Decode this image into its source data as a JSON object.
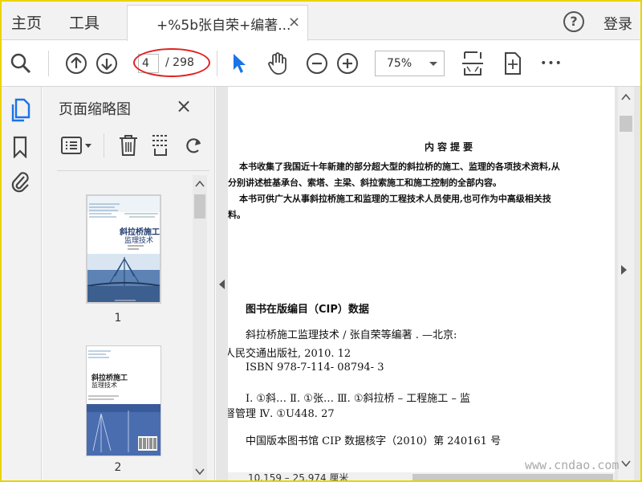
{
  "tabbar": {
    "home": "主页",
    "tools": "工具",
    "doc_tab_title": "+%5b张自荣+编著...",
    "close_glyph": "×",
    "help_glyph": "?",
    "login": "登录"
  },
  "toolbar": {
    "current_page": "4",
    "total_pages": "/ 298",
    "zoom": "75%",
    "more": "•••"
  },
  "sidebar": {
    "panel_title": "页面缩略图",
    "thumbnails": [
      {
        "label": "1",
        "cover_title": "斜拉桥施工",
        "cover_subtitle": "监理技术"
      },
      {
        "label": "2",
        "cover_title": "斜拉桥施工",
        "cover_subtitle": "监理技术"
      }
    ]
  },
  "document": {
    "summary_title": "内容提要",
    "summary_lines": [
      "本书收集了我国近十年新建的部分超大型的斜拉桥的施工、监理的各项技术资料,从",
      "分别讲述桩基承台、索塔、主梁、斜拉索施工和施工控制的全部内容。",
      "本书可供广大从事斜拉桥施工和监理的工程技术人员使用,也可作为中高级相关技",
      "料。"
    ],
    "cip_title": "图书在版编目（CIP）数据",
    "cip_line1": "斜拉桥施工监理技术 / 张自荣等编著 . —北京:",
    "cip_line2": "人民交通出版社, 2010. 12",
    "cip_isbn": "ISBN 978-7-114- 08794- 3",
    "cip_class1": "Ⅰ. ①斜… Ⅱ. ①张… Ⅲ. ①斜拉桥 – 工程施工 – 监",
    "cip_class2": "督管理 Ⅳ. ①U448. 27",
    "cip_record": "中国版本图书馆 CIP 数据核字（2010）第 240161 号",
    "cut_line": "10.159 – 25.974 厘米"
  },
  "watermark": "www.cndao.com",
  "colors": {
    "accent_blue": "#1a73e8",
    "annotation_red": "#e02020",
    "frame_yellow": "#e9d400"
  }
}
